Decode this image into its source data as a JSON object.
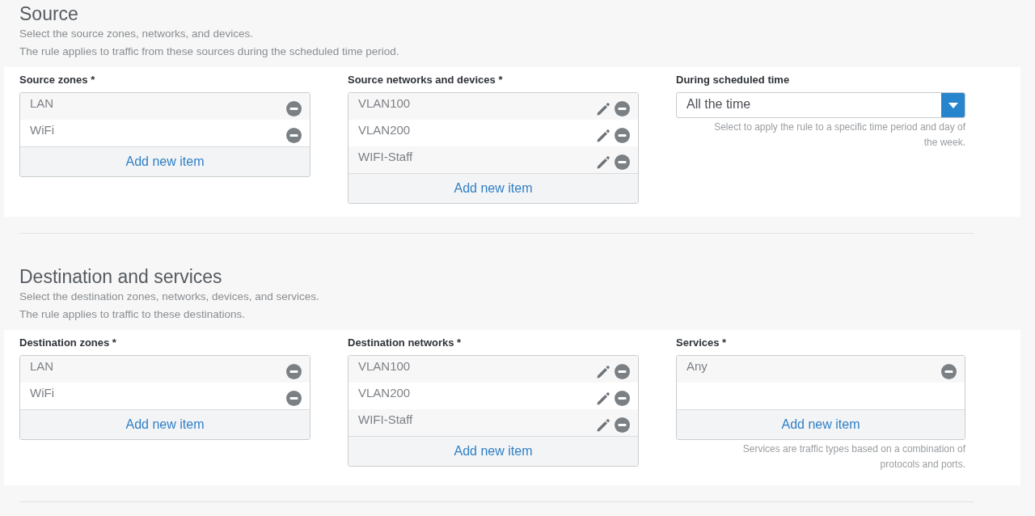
{
  "sections": [
    {
      "title": "Source",
      "description": [
        "Select the source zones, networks, and devices.",
        "The rule applies to traffic from these sources during the scheduled time period."
      ],
      "fields": [
        {
          "kind": "list",
          "label": "Source zones *",
          "items": [
            {
              "text": "LAN",
              "editable": false
            },
            {
              "text": "WiFi",
              "editable": false
            }
          ],
          "add_label": "Add new item"
        },
        {
          "kind": "list",
          "label": "Source networks and devices *",
          "items": [
            {
              "text": "VLAN100",
              "editable": true
            },
            {
              "text": "VLAN200",
              "editable": true
            },
            {
              "text": "WIFI-Staff",
              "editable": true
            }
          ],
          "add_label": "Add new item"
        },
        {
          "kind": "select",
          "label": "During scheduled time",
          "value": "All the time",
          "help": "Select to apply the rule to a specific time period and day of the week."
        }
      ]
    },
    {
      "title": "Destination and services",
      "description": [
        "Select the destination zones, networks, devices, and services.",
        "The rule applies to traffic to these destinations."
      ],
      "fields": [
        {
          "kind": "list",
          "label": "Destination zones *",
          "items": [
            {
              "text": "LAN",
              "editable": false
            },
            {
              "text": "WiFi",
              "editable": false
            }
          ],
          "add_label": "Add new item"
        },
        {
          "kind": "list",
          "label": "Destination networks *",
          "items": [
            {
              "text": "VLAN100",
              "editable": true
            },
            {
              "text": "VLAN200",
              "editable": true
            },
            {
              "text": "WIFI-Staff",
              "editable": true
            }
          ],
          "add_label": "Add new item"
        },
        {
          "kind": "list",
          "label": "Services *",
          "items": [
            {
              "text": "Any",
              "editable": false
            }
          ],
          "add_label": "Add new item",
          "help": "Services are traffic types based on a combination of protocols and ports."
        }
      ]
    }
  ]
}
